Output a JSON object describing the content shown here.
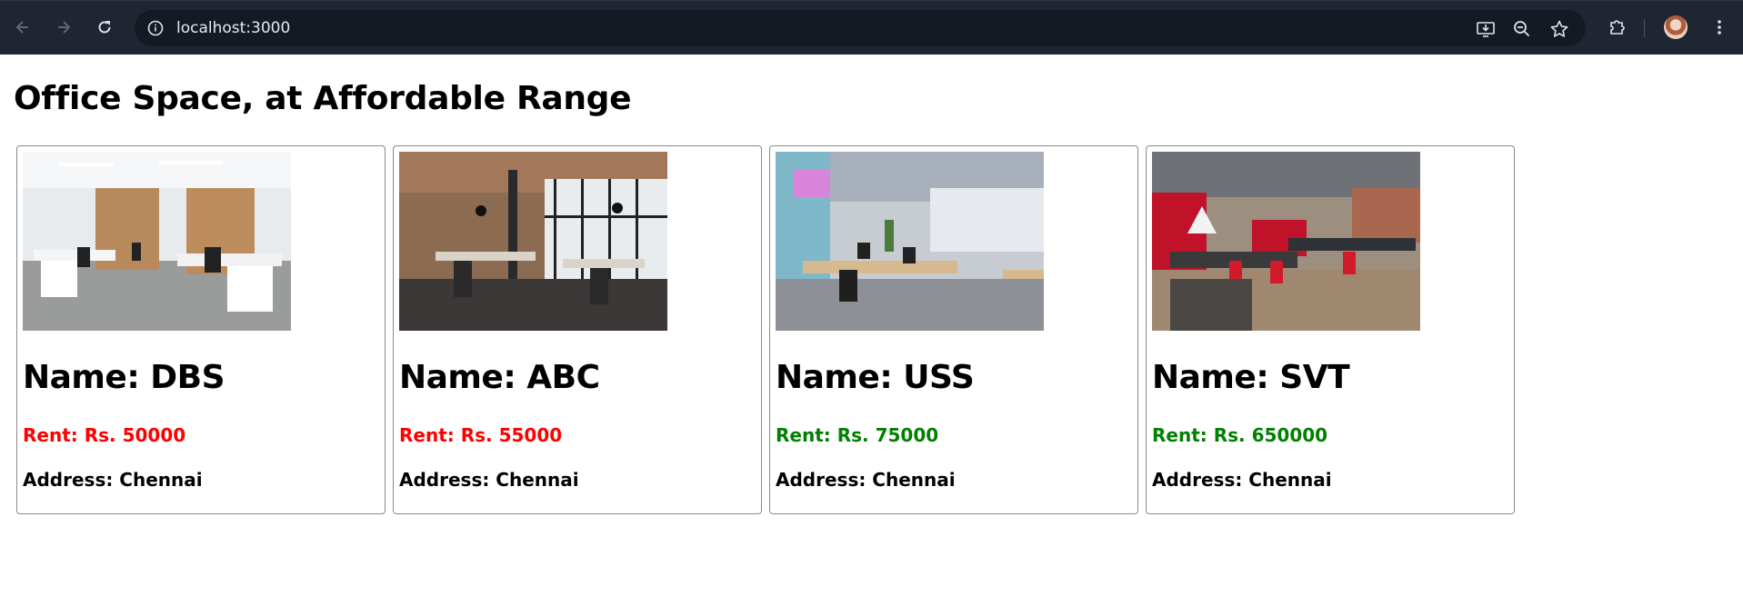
{
  "browser": {
    "url": "localhost:3000",
    "icons": {
      "back": "arrow-left-icon",
      "forward": "arrow-right-icon",
      "reload": "reload-icon",
      "site_info": "info-icon",
      "install": "install-app-icon",
      "zoom": "zoom-icon",
      "bookmark": "star-icon",
      "extensions": "puzzle-icon",
      "profile": "avatar",
      "menu": "kebab-menu-icon"
    }
  },
  "page": {
    "title": "Office Space, at Affordable Range"
  },
  "colors": {
    "rent_low": "#ff0000",
    "rent_high": "#008000",
    "chrome_bg": "#1f2632",
    "omnibox_bg": "#141a23"
  },
  "offices": [
    {
      "name": "Name: DBS",
      "rent": "Rent: Rs. 50000",
      "address": "Address: Chennai",
      "rent_color": "#ff0000"
    },
    {
      "name": "Name: ABC",
      "rent": "Rent: Rs. 55000",
      "address": "Address: Chennai",
      "rent_color": "#ff0000"
    },
    {
      "name": "Name: USS",
      "rent": "Rent: Rs. 75000",
      "address": "Address: Chennai",
      "rent_color": "#008000"
    },
    {
      "name": "Name: SVT",
      "rent": "Rent: Rs. 650000",
      "address": "Address: Chennai",
      "rent_color": "#008000"
    }
  ]
}
